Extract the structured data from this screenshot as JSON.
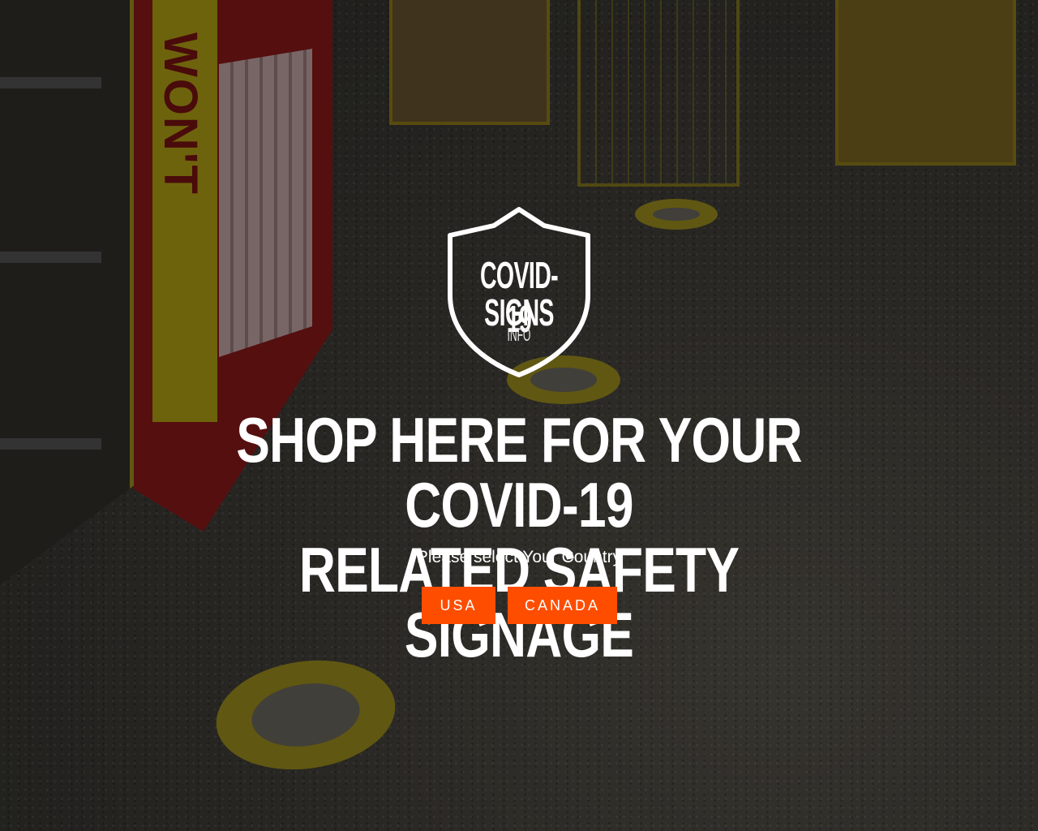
{
  "logo": {
    "line1": "COVID-19",
    "line2": "SIGNS",
    "line3": "INFO",
    "icon": "shield-icon"
  },
  "hero": {
    "headline_line1": "SHOP HERE FOR YOUR COVID-19",
    "headline_line2": "RELATED SAFETY SIGNAGE",
    "subtitle": "Please select Your Country"
  },
  "countries": {
    "usa_label": "USA",
    "canada_label": "CANADA"
  },
  "colors": {
    "button_bg": "#ff4d00",
    "text": "#ffffff",
    "overlay": "rgba(0,0,0,0.30)"
  }
}
